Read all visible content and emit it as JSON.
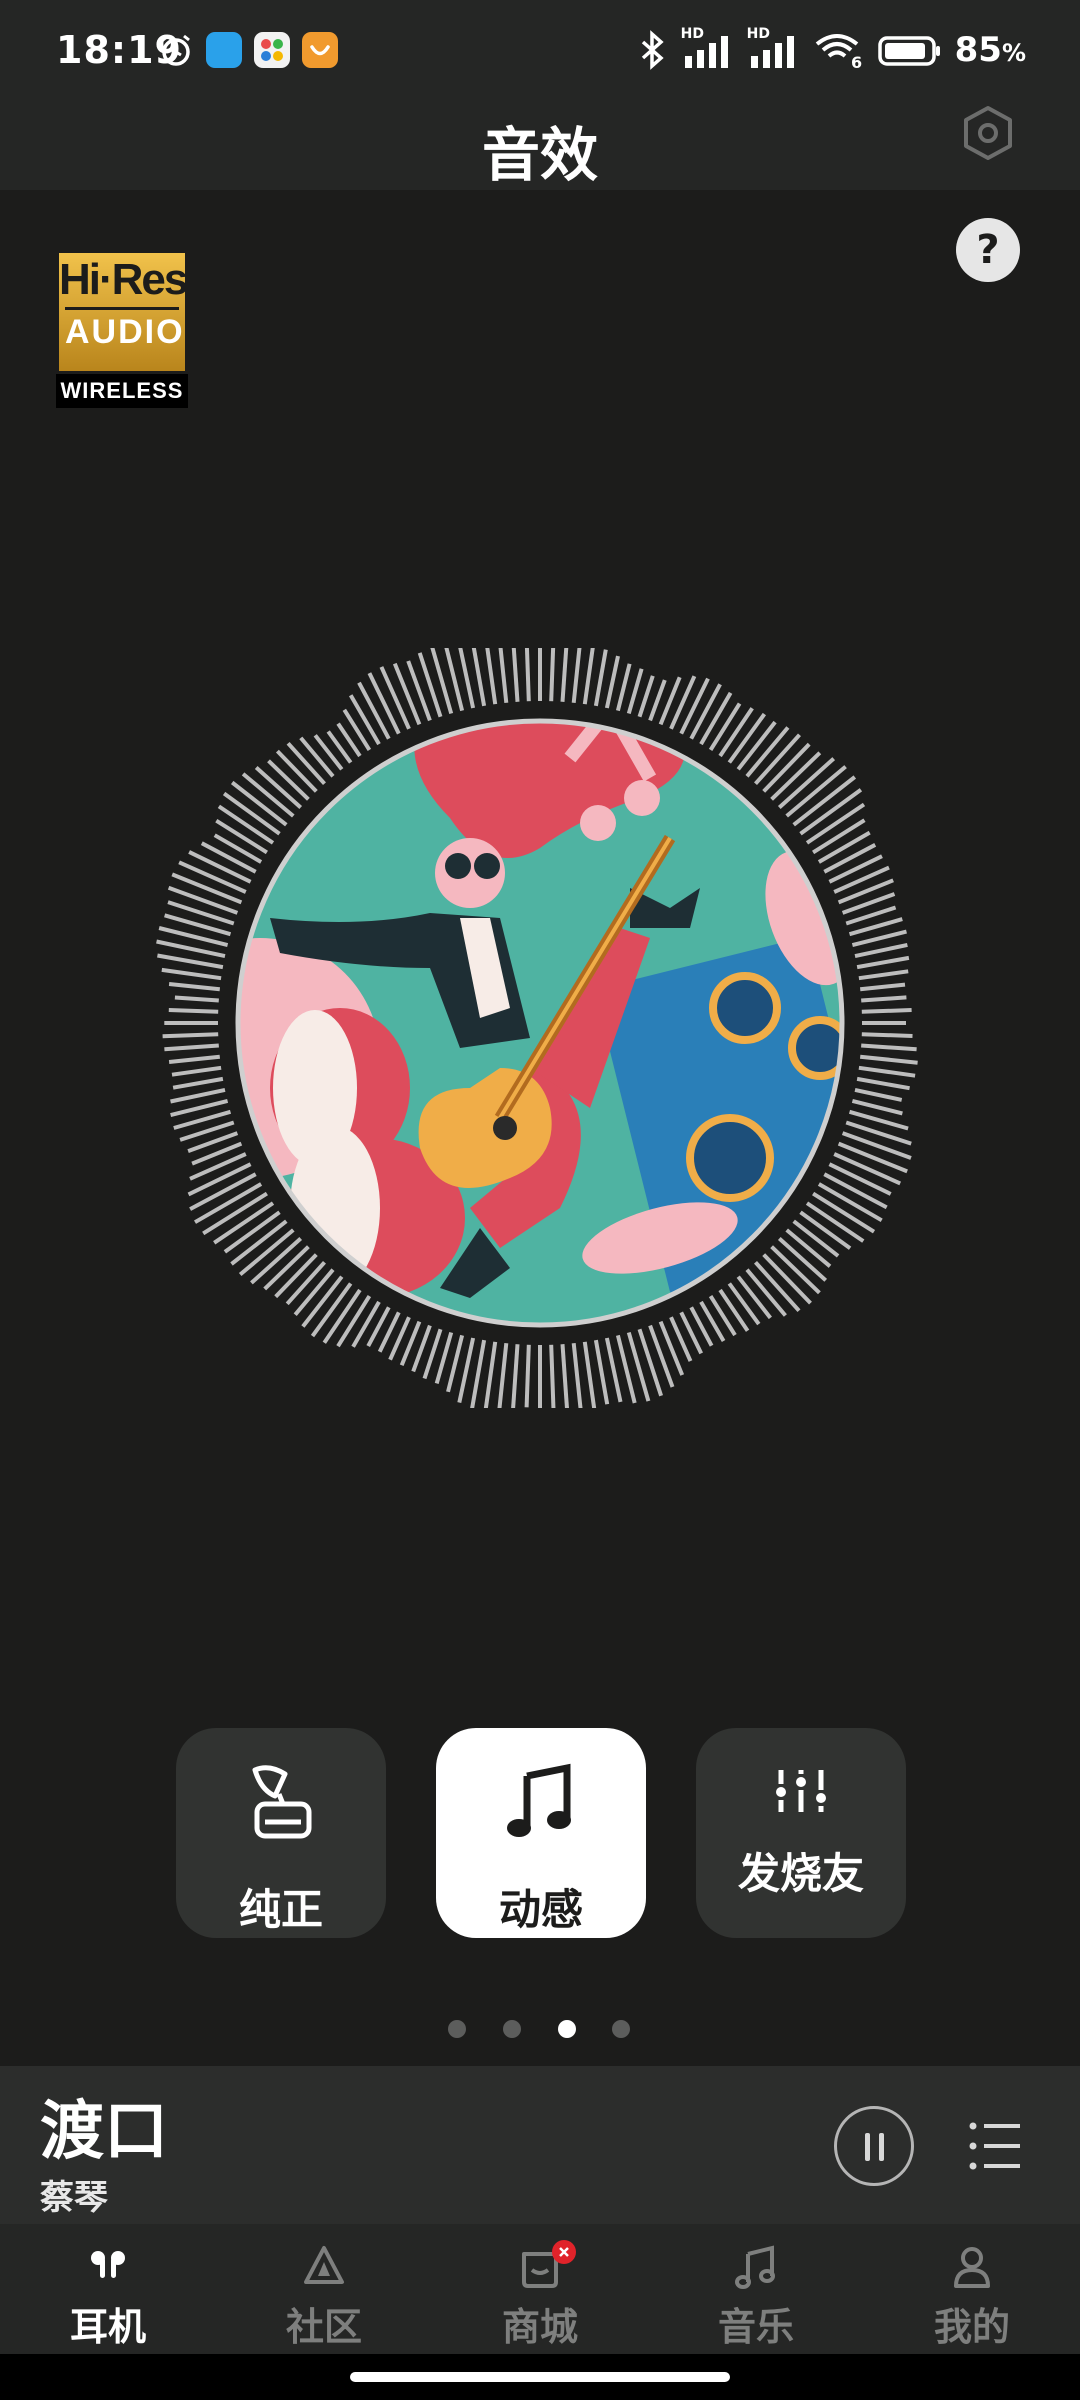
{
  "status_bar": {
    "time": "18:19",
    "battery_percent": "85",
    "battery_suffix": "%",
    "network_labels": [
      "HD",
      "HD"
    ],
    "icons": [
      "alarm-icon",
      "app-notification-blue",
      "app-notification-multicolor",
      "app-notification-orange",
      "bluetooth-icon",
      "signal-icon",
      "signal-icon",
      "wifi-6-icon",
      "battery-icon"
    ]
  },
  "header": {
    "title": "音效",
    "settings_icon": "hexagon-settings-icon"
  },
  "help": {
    "label": "?"
  },
  "badge": {
    "line1": "Hi·Res",
    "line2": "AUDIO",
    "line3": "WIRELESS"
  },
  "visualizer": {
    "artwork": "guitarist-illustration",
    "colors": {
      "teal": "#4fb3a2",
      "red": "#dd4c5c",
      "pink": "#f5b8c0",
      "blue": "#2a7fb8",
      "guitar": "#f0ad48"
    }
  },
  "modes": [
    {
      "label": "纯正",
      "icon": "gramophone-icon",
      "active": false
    },
    {
      "label": "动感",
      "icon": "music-note-icon",
      "active": true
    },
    {
      "label": "发烧友",
      "icon": "equalizer-icon",
      "active": false
    }
  ],
  "pager": {
    "count": 4,
    "active_index": 2
  },
  "now_playing": {
    "title": "渡口",
    "artist": "蔡琴",
    "state": "playing"
  },
  "bottom_nav": {
    "items": [
      {
        "label": "耳机",
        "icon": "earbuds-icon",
        "active": true
      },
      {
        "label": "社区",
        "icon": "triangle-compass-icon",
        "active": false
      },
      {
        "label": "商城",
        "icon": "shopping-bag-icon",
        "active": false,
        "badge": true
      },
      {
        "label": "音乐",
        "icon": "music-note-icon",
        "active": false
      },
      {
        "label": "我的",
        "icon": "user-icon",
        "active": false
      }
    ]
  },
  "accent_colors": {
    "background": "#1c1c1b",
    "card": "#313331",
    "card_active": "#ffffff",
    "badge_red": "#e0232a"
  }
}
